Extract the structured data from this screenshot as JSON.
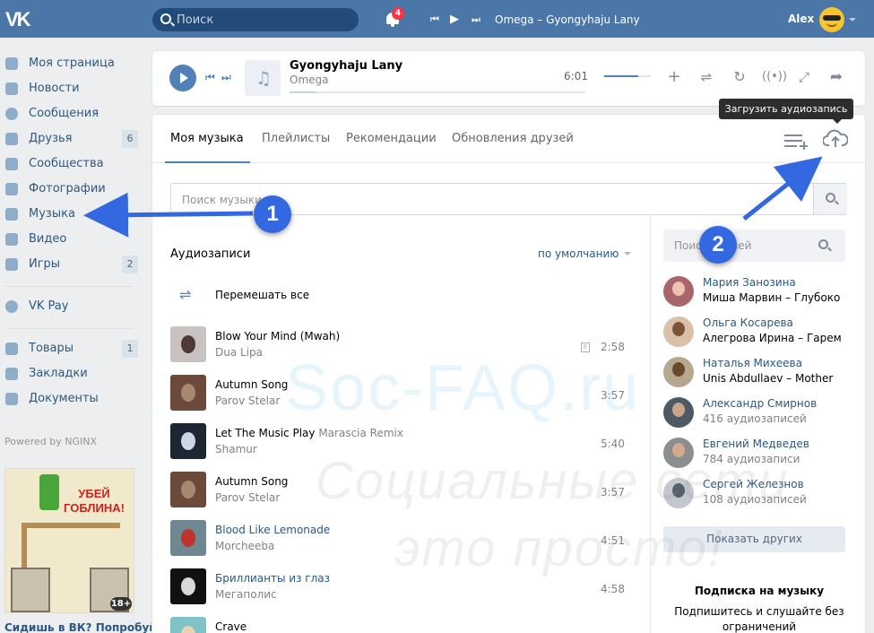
{
  "topbar": {
    "logo": "VK",
    "search_placeholder": "Поиск",
    "notifications_count": "4",
    "now_playing": "Omega – Gyongyhaju Lany",
    "user_name": "Alex"
  },
  "sidebar": {
    "items": [
      {
        "label": "Моя страница",
        "icon": "user-icon",
        "count": ""
      },
      {
        "label": "Новости",
        "icon": "news-icon",
        "count": ""
      },
      {
        "label": "Сообщения",
        "icon": "chat-icon",
        "count": ""
      },
      {
        "label": "Друзья",
        "icon": "friend-icon",
        "count": "6"
      },
      {
        "label": "Сообщества",
        "icon": "groups-icon",
        "count": ""
      },
      {
        "label": "Фотографии",
        "icon": "camera-icon",
        "count": ""
      },
      {
        "label": "Музыка",
        "icon": "music-note-icon",
        "count": ""
      },
      {
        "label": "Видео",
        "icon": "film-icon",
        "count": ""
      },
      {
        "label": "Игры",
        "icon": "gamepad-icon",
        "count": "2"
      },
      {
        "label": "VK Pay",
        "icon": "ruble-icon",
        "count": ""
      },
      {
        "label": "Товары",
        "icon": "bag-icon",
        "count": "1"
      },
      {
        "label": "Закладки",
        "icon": "star-icon",
        "count": ""
      },
      {
        "label": "Документы",
        "icon": "document-icon",
        "count": ""
      }
    ],
    "powered": "Powered by NGINX",
    "ad_title": "УБЕЙ ГОБЛИНА!",
    "ad_age": "18+",
    "ad_caption": "Сидишь в ВК? Попробуй"
  },
  "player": {
    "title": "Gyongyhaju Lany",
    "artist": "Omega",
    "duration": "6:01"
  },
  "tooltip": "Загрузить аудиозапись",
  "tabs": [
    "Моя музыка",
    "Плейлисты",
    "Рекомендации",
    "Обновления друзей"
  ],
  "music_search_placeholder": "Поиск музыки",
  "audio_heading": "Аудиозаписи",
  "sort": "по умолчанию",
  "shuffle": "Перемешать все",
  "tracks": [
    {
      "title": "Blow Your Mind (Mwah)",
      "sub": "",
      "artist": "Dua Lipa",
      "duration": "2:58",
      "explicit": "E",
      "link": false
    },
    {
      "title": "Autumn Song",
      "sub": "",
      "artist": "Parov Stelar",
      "duration": "3:57",
      "explicit": "",
      "link": false
    },
    {
      "title": "Let The Music Play",
      "sub": "Marascia Remix",
      "artist": "Shamur",
      "duration": "5:40",
      "explicit": "",
      "link": false
    },
    {
      "title": "Autumn Song",
      "sub": "",
      "artist": "Parov Stelar",
      "duration": "3:57",
      "explicit": "",
      "link": false
    },
    {
      "title": "Blood Like Lemonade",
      "sub": "",
      "artist": "Morcheeba",
      "duration": "4:51",
      "explicit": "",
      "link": true
    },
    {
      "title": "Бриллианты из глаз",
      "sub": "",
      "artist": "Мегаполис",
      "duration": "4:58",
      "explicit": "",
      "link": true
    },
    {
      "title": "Crave",
      "sub": "",
      "artist": "",
      "duration": "",
      "explicit": "",
      "link": false
    }
  ],
  "friend_search_placeholder": "Поиск друзей",
  "friends": [
    {
      "name": "Мария Занозина",
      "sub": "Миша Марвин – Глубоко",
      "is_count": false
    },
    {
      "name": "Ольга Косарева",
      "sub": "Алегрова Ирина – Гарем",
      "is_count": false
    },
    {
      "name": "Наталья Михеева",
      "sub": "Unis Abdullaev – Mother",
      "is_count": false
    },
    {
      "name": "Александр Смирнов",
      "sub": "416 аудиозаписей",
      "is_count": true
    },
    {
      "name": "Евгений Медведев",
      "sub": "784 аудиозаписи",
      "is_count": true
    },
    {
      "name": "Сергей Железнов",
      "sub": "108 аудиозаписей",
      "is_count": true
    }
  ],
  "show_more": "Показать других",
  "subscription": {
    "title": "Подписка на музыку",
    "text": "Подпишитесь и слушайте без ограничений"
  },
  "watermark": [
    "Soc-FAQ.ru",
    "Социальные сети",
    "это просто!"
  ],
  "annotations": [
    "1",
    "2"
  ],
  "colors": {
    "brand": "#4a76a8",
    "accent": "#5181b8",
    "link": "#2a5885",
    "annotation": "#3468e0"
  }
}
